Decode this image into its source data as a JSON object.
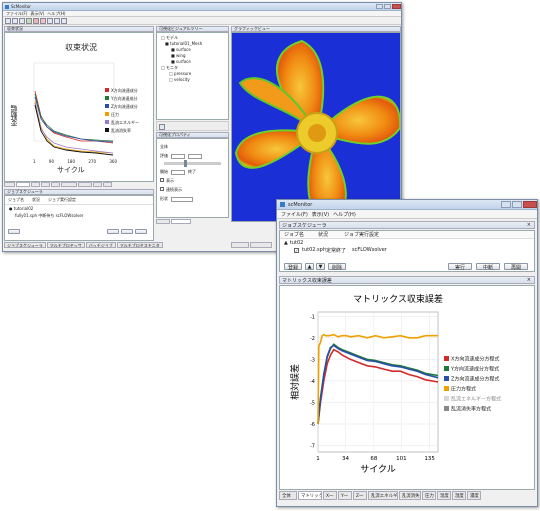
{
  "back": {
    "title": "ScMonitor",
    "menu": [
      "ファイル(F)",
      "表示(V)",
      "ヘルプ(H)"
    ],
    "pane_convergence": "収束状況",
    "chart_title": "収束状況",
    "chart_ylabel": "変動幅",
    "chart_xlabel": "サイクル",
    "x_ticks": [
      "1",
      "90",
      "180",
      "270",
      "360"
    ],
    "legend": [
      "X方向流速成分",
      "Y方向流速成分",
      "Z方向流速成分",
      "圧力",
      "乱流エネルギー",
      "乱流消失率"
    ],
    "legend_colors": [
      "#d42a2a",
      "#1f7a3a",
      "#2b4ea8",
      "#f0a000",
      "#9a7ad0",
      "#111111"
    ],
    "pane_jobs": "ジョブスケジューラ",
    "jobs_cols": [
      "ジョブ名",
      "状況",
      "ジョブ実行設定"
    ],
    "jobs_rows": [
      "● tutorial02",
      "fully01.sph    中断待ち    scFLOWsolver"
    ],
    "bottom_tabs": [
      "ジョブスケジューラ",
      "マルチプロセッサ",
      "バッチジョブ",
      "マルチプロセスモニタ"
    ],
    "pane_field": "可視化ビジュアルツリー",
    "tree": [
      "□ モデル",
      "■ tutorial01_Mesh",
      "■ surface",
      "■ wing",
      "■ surface",
      "□ モニタ",
      "□ pressure",
      "□ velocity"
    ],
    "pane_props": "可視化プロパティ",
    "pane_view": "グラフィックビュー",
    "props_labels": [
      "全体",
      "評価",
      "開始",
      "終了",
      "表示",
      "連続表示",
      "形状"
    ]
  },
  "front": {
    "title": "scMonitor",
    "menu": [
      "ファイル(F)",
      "表示(V)",
      "ヘルプ(H)"
    ],
    "pane_jobs": "ジョブスケジューラ",
    "jobs_cols": [
      "ジョブ名",
      "状況",
      "ジョブ実行設定"
    ],
    "job_group": "tut02",
    "job_name": "tut02.sph",
    "job_status": "定常終了",
    "job_setting": "scFLOWsolver",
    "btn_left": [
      "登録",
      "削除"
    ],
    "btn_right": [
      "実行",
      "中断",
      "再開"
    ],
    "pane_residual": "マトリックス収束誤差",
    "tabs": [
      "全体",
      "マトリックス",
      "X一",
      "Y一",
      "Z一",
      "乱流エネルギー",
      "乱流消失率",
      "圧力",
      "温度",
      "湿度",
      "濃度"
    ],
    "active_tab": 1
  },
  "chart_data": {
    "type": "line",
    "title": "マトリックス収束誤差",
    "xlabel": "サイクル",
    "ylabel": "相対誤差",
    "x_ticks": [
      1,
      34,
      68,
      101,
      135
    ],
    "y_ticks": [
      -1,
      -2,
      -3,
      -4,
      -5,
      -6,
      -7
    ],
    "xlim": [
      1,
      145
    ],
    "ylim": [
      -7.3,
      -0.8
    ],
    "grid": true,
    "legend_position": "right",
    "series": [
      {
        "name": "X方向流速成分方程式",
        "color": "#d42a2a",
        "x": [
          1,
          4,
          8,
          12,
          16,
          20,
          25,
          30,
          40,
          50,
          60,
          70,
          80,
          90,
          100,
          110,
          120,
          130,
          145
        ],
        "y": [
          -6.0,
          -5.0,
          -4.0,
          -3.2,
          -2.8,
          -2.55,
          -2.65,
          -2.8,
          -3.0,
          -3.15,
          -3.3,
          -3.35,
          -3.45,
          -3.55,
          -3.55,
          -3.7,
          -3.8,
          -3.95,
          -4.05
        ]
      },
      {
        "name": "Y方向流速成分方程式",
        "color": "#1f7a3a",
        "x": [
          1,
          4,
          8,
          12,
          16,
          20,
          25,
          30,
          40,
          50,
          60,
          70,
          80,
          90,
          100,
          110,
          120,
          130,
          145
        ],
        "y": [
          -6.0,
          -4.8,
          -3.7,
          -2.9,
          -2.5,
          -2.3,
          -2.45,
          -2.55,
          -2.7,
          -2.85,
          -3.0,
          -3.05,
          -3.15,
          -3.25,
          -3.3,
          -3.4,
          -3.5,
          -3.65,
          -3.75
        ]
      },
      {
        "name": "Z方向流速成分方程式",
        "color": "#2b4ea8",
        "x": [
          1,
          4,
          8,
          12,
          16,
          20,
          25,
          30,
          40,
          50,
          60,
          70,
          80,
          90,
          100,
          110,
          120,
          130,
          145
        ],
        "y": [
          -6.0,
          -4.8,
          -3.7,
          -2.85,
          -2.45,
          -2.35,
          -2.5,
          -2.6,
          -2.75,
          -2.9,
          -3.05,
          -3.1,
          -3.2,
          -3.3,
          -3.35,
          -3.45,
          -3.55,
          -3.7,
          -3.85
        ]
      },
      {
        "name": "圧力方程式",
        "color": "#f0a000",
        "x": [
          1,
          2,
          4,
          6,
          8,
          10,
          15,
          20,
          25,
          30,
          35,
          40,
          50,
          60,
          70,
          80,
          90,
          100,
          110,
          120,
          130,
          145
        ],
        "y": [
          -6.0,
          -2.4,
          -2.2,
          -1.9,
          -1.85,
          -1.9,
          -1.9,
          -1.85,
          -1.95,
          -1.9,
          -1.9,
          -1.95,
          -1.9,
          -2.0,
          -1.9,
          -2.0,
          -1.95,
          -1.9,
          -2.0,
          -2.0,
          -1.9,
          -1.9
        ]
      },
      {
        "name": "乱流エネルギー方程式",
        "color": "#d8d8d8",
        "x": [],
        "y": []
      },
      {
        "name": "乱流消失率方程式",
        "color": "#888888",
        "x": [],
        "y": []
      }
    ]
  }
}
